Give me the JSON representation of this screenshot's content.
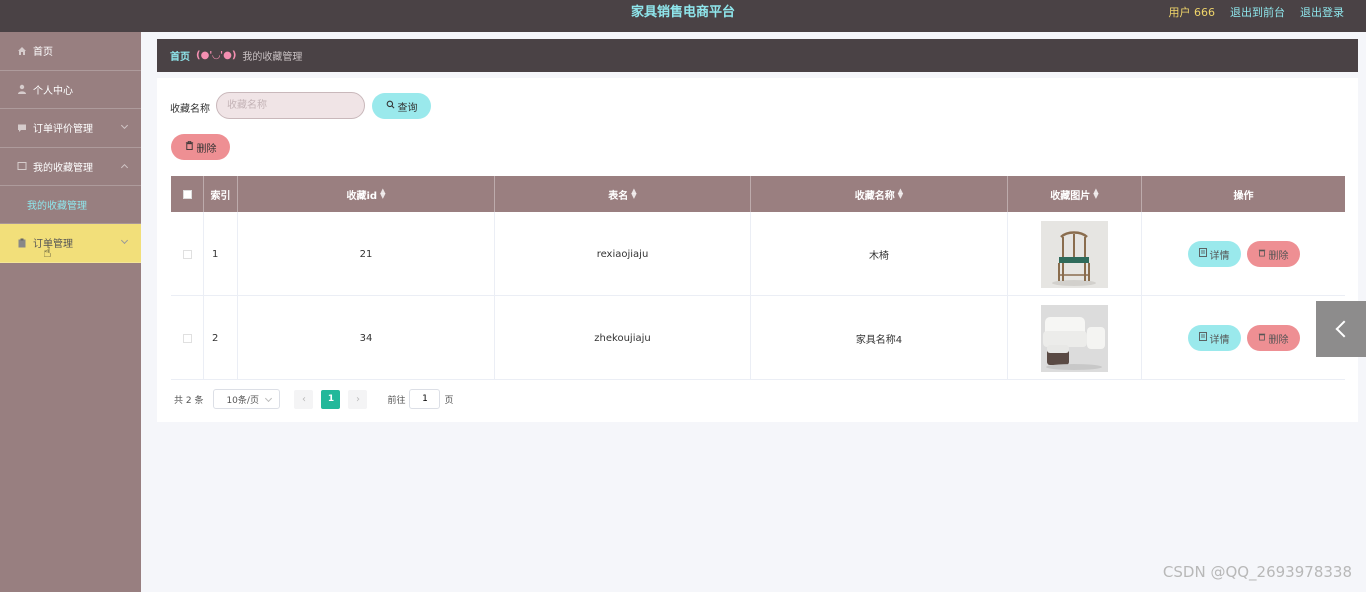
{
  "header": {
    "title": "家具销售电商平台",
    "user": "用户 666",
    "front_link": "退出到前台",
    "logout_link": "退出登录"
  },
  "sidebar": {
    "items": [
      {
        "label": "首页",
        "icon": "home-icon"
      },
      {
        "label": "个人中心",
        "icon": "user-icon"
      },
      {
        "label": "订单评价管理",
        "icon": "comment-icon"
      },
      {
        "label": "我的收藏管理",
        "icon": "star-icon"
      },
      {
        "label": "订单管理",
        "icon": "clipboard-icon"
      }
    ],
    "sub_item": "我的收藏管理"
  },
  "breadcrumb": {
    "home": "首页",
    "face": "(●'◡'●)",
    "current": "我的收藏管理"
  },
  "search": {
    "label": "收藏名称",
    "placeholder": "收藏名称",
    "query_button": "查询",
    "delete_button": "删除"
  },
  "table": {
    "headers": [
      "索引",
      "收藏id",
      "表名",
      "收藏名称",
      "收藏图片",
      "操作"
    ],
    "rows": [
      {
        "index": "1",
        "id": "21",
        "table_name": "rexiaojiaju",
        "name": "木椅",
        "image": "chair-image"
      },
      {
        "index": "2",
        "id": "34",
        "table_name": "zhekoujiaju",
        "name": "家具名称4",
        "image": "sofa-image"
      }
    ],
    "detail_button": "详情",
    "delete_button": "删除"
  },
  "pagination": {
    "total": "共 2 条",
    "page_size": "10条/页",
    "current_page": "1",
    "goto_label": "前往",
    "goto_value": "1",
    "page_unit": "页"
  },
  "watermark": "CSDN @QQ_2693978338",
  "colors": {
    "header_bg": "#4a4245",
    "sidebar_bg": "#987f80",
    "active_item": "#f2df7a",
    "accent_cyan": "#9ae9ec",
    "accent_red": "#ee8f93",
    "page_active": "#22b89a"
  }
}
